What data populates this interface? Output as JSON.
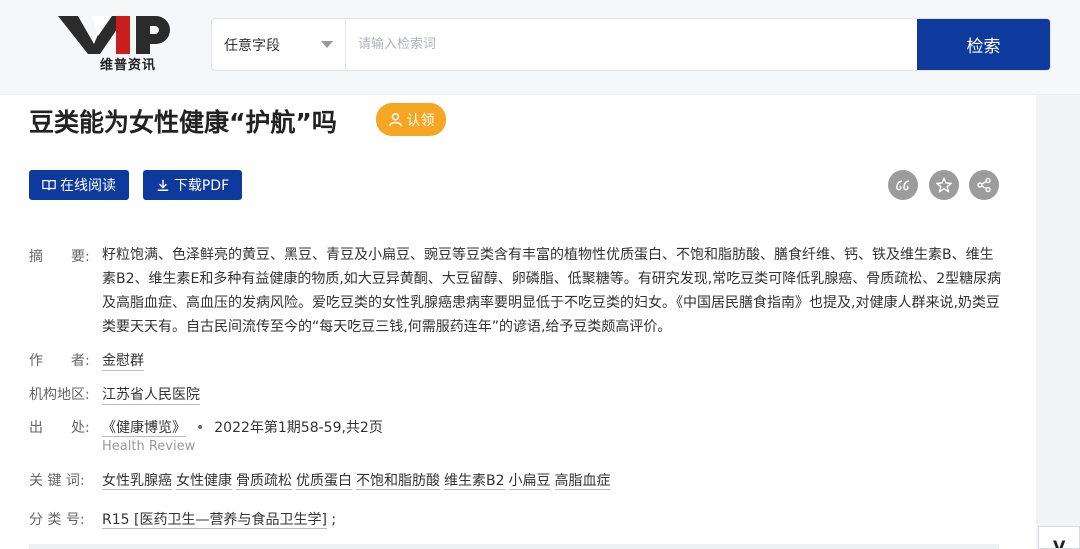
{
  "header": {
    "logo_sub": "维普资讯",
    "field_select": "任意字段",
    "search_placeholder": "请输入检索词",
    "search_button": "检索"
  },
  "article": {
    "title": "豆类能为女性健康“护航”吗",
    "claim_label": "认领",
    "read_online": "在线阅读",
    "download_pdf": "下载PDF"
  },
  "meta": {
    "abstract_label": "摘　　要:",
    "abstract_text": "籽粒饱满、色泽鲜亮的黄豆、黑豆、青豆及小扁豆、豌豆等豆类含有丰富的植物性优质蛋白、不饱和脂肪酸、膳食纤维、钙、铁及维生素B、维生素B2、维生素E和多种有益健康的物质,如大豆异黄酮、大豆留醇、卵磷脂、低聚糖等。有研究发现,常吃豆类可降低乳腺癌、骨质疏松、2型糖尿病及高脂血症、高血压的发病风险。爱吃豆类的女性乳腺癌患病率要明显低于不吃豆类的妇女。《中国居民膳食指南》也提及,对健康人群来说,奶类豆类要天天有。自古民间流传至今的“每天吃豆三钱,何需服药连年”的谚语,给予豆类颇高评价。",
    "author_label": "作　　者:",
    "author": "金慰群",
    "org_label": "机构地区:",
    "org": "江苏省人民医院",
    "source_label": "出　　处:",
    "source_journal": "《健康博览》",
    "source_dot": "•",
    "source_issue": "2022年第1期58-59,共2页",
    "source_en": "Health Review",
    "keywords_label": "关 键 词:",
    "keywords": [
      "女性乳腺癌",
      "女性健康",
      "骨质疏松",
      "优质蛋白",
      "不饱和脂肪酸",
      "维生素B2",
      "小扁豆",
      "高脂血症"
    ],
    "class_label": "分 类 号:",
    "class_code": "R15 [医药卫生—营养与食品卫生学]",
    "class_tail": ";"
  },
  "colors": {
    "brand_blue": "#0d3a9c",
    "claim_orange": "#f5a623",
    "icon_gray": "#9c9c9c"
  },
  "icons": [
    "vip-logo",
    "chevron-down-icon",
    "user-icon",
    "book-icon",
    "download-icon",
    "quote-icon",
    "star-icon",
    "share-icon"
  ]
}
